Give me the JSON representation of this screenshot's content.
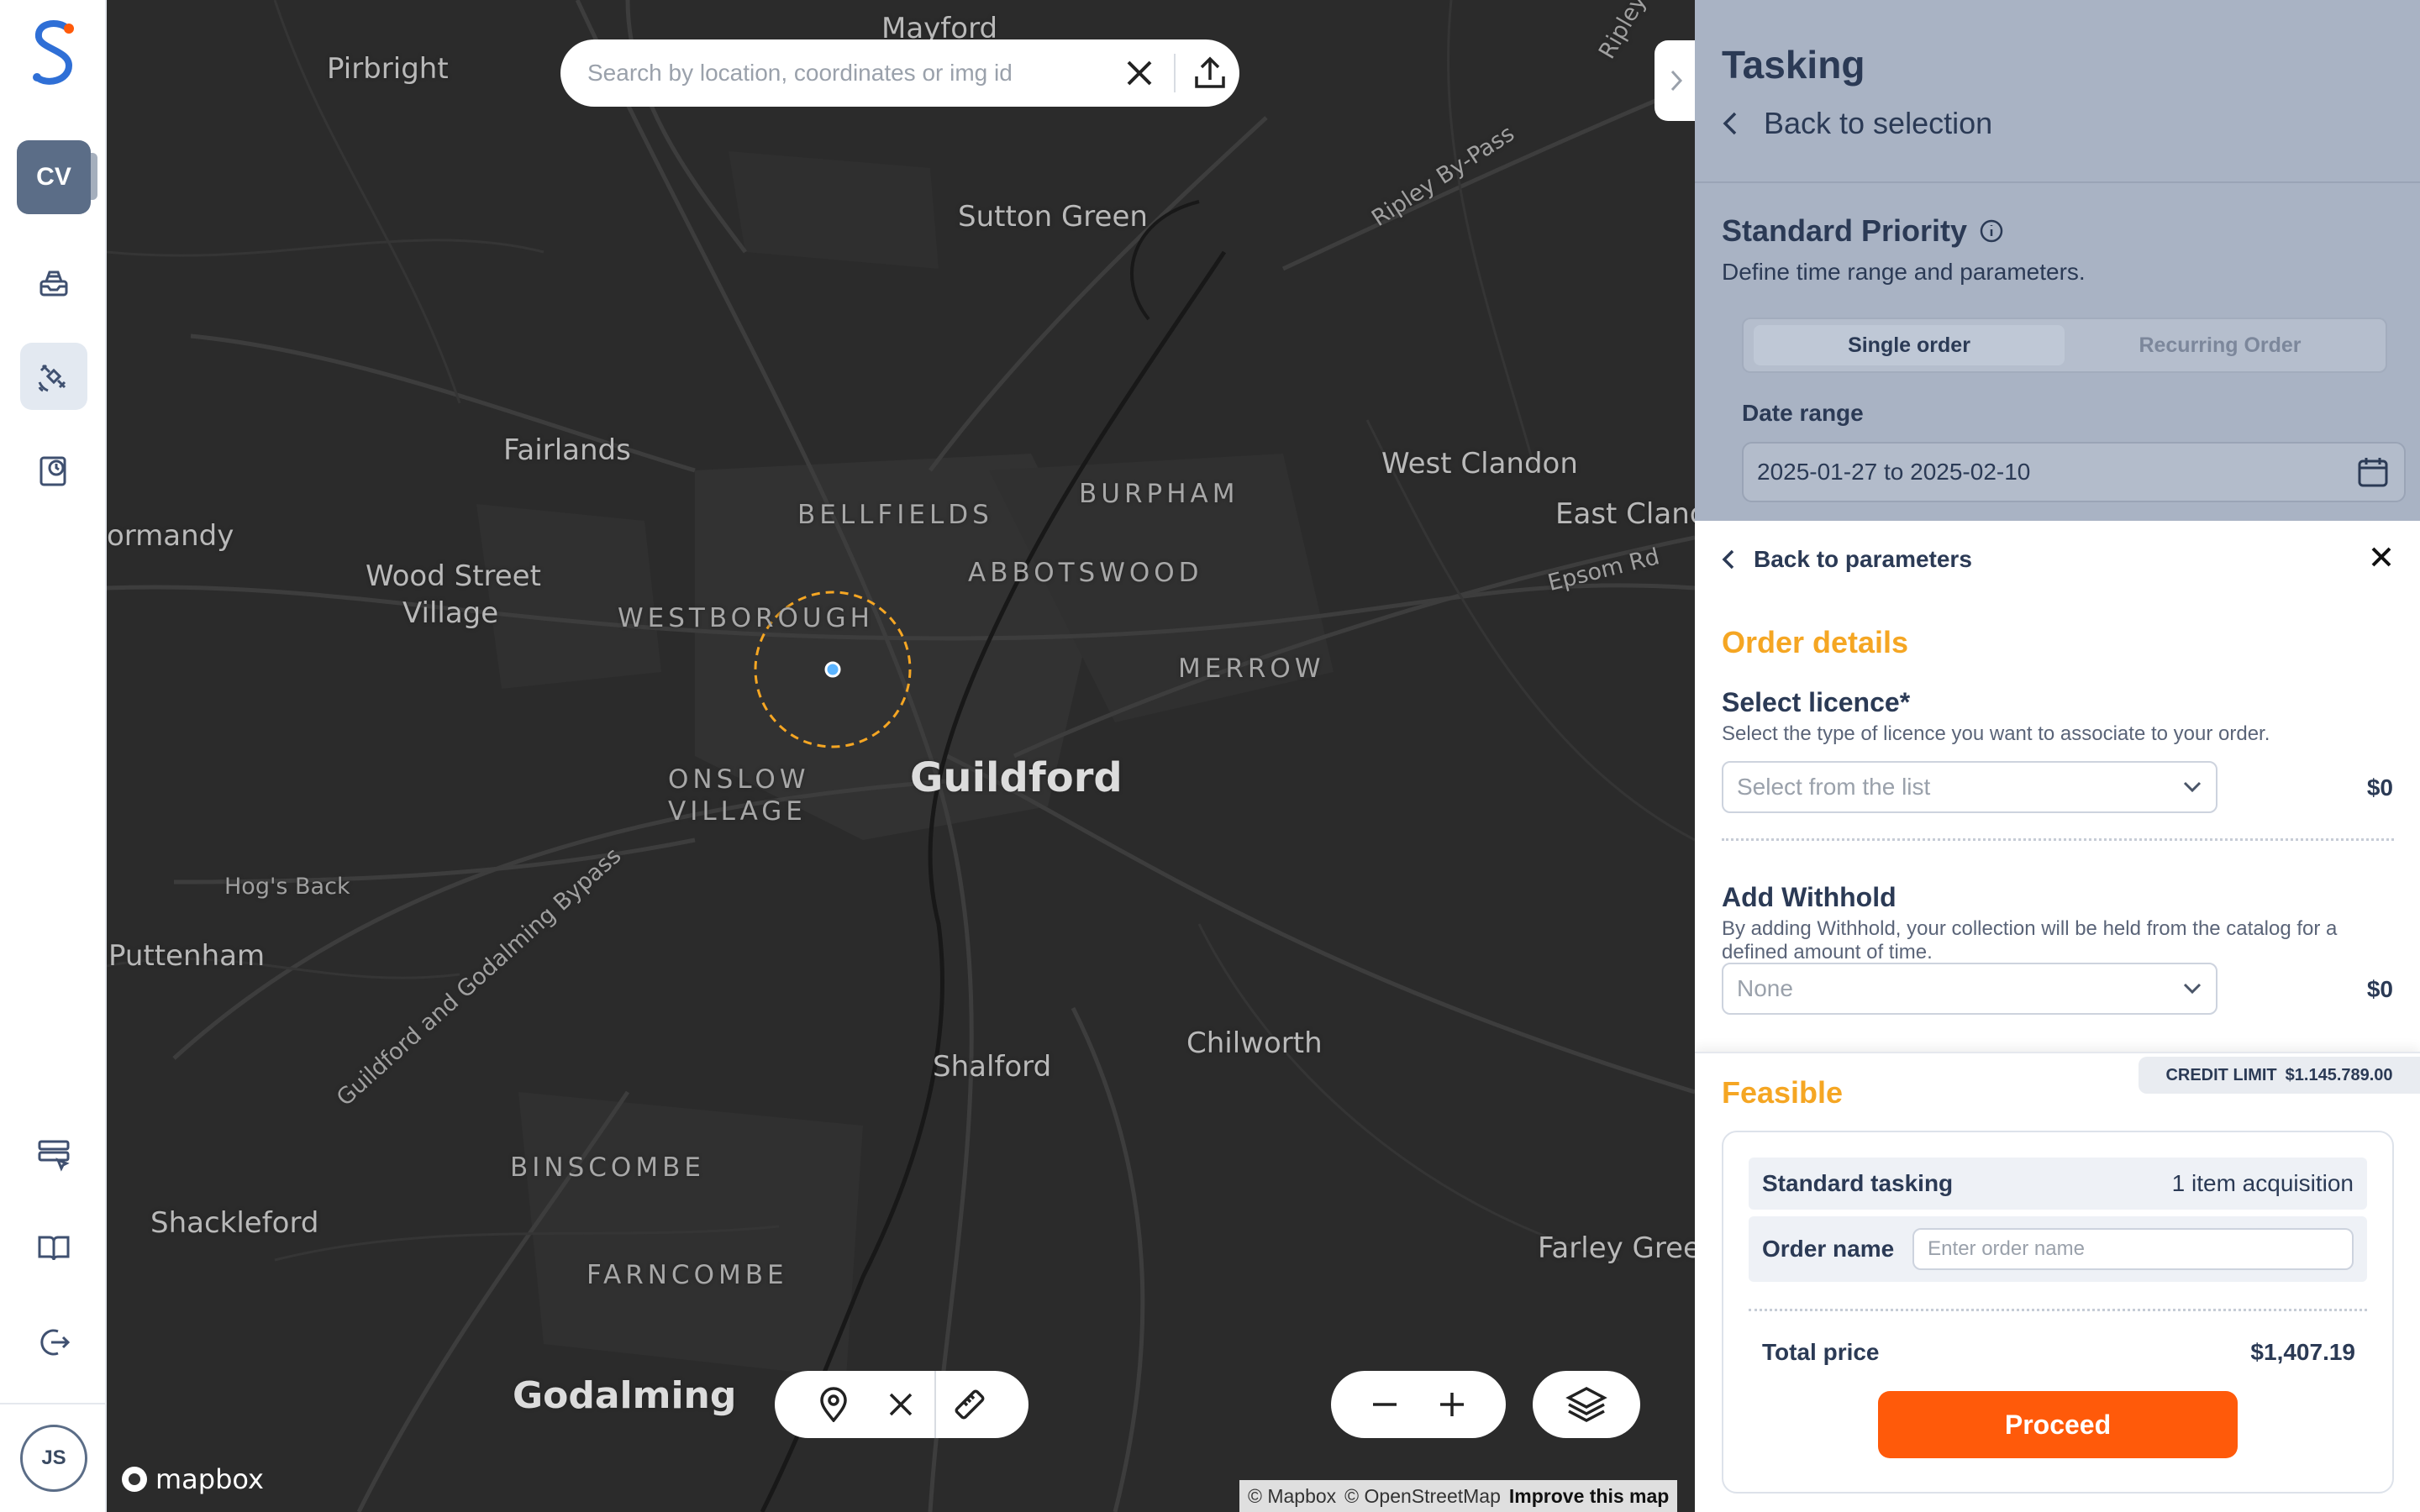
{
  "nav": {
    "workspace_initials": "CV",
    "user_initials": "JS",
    "items": [
      {
        "name": "inbox"
      },
      {
        "name": "satellite"
      },
      {
        "name": "history"
      }
    ],
    "bottom_items": [
      {
        "name": "tasking-list"
      },
      {
        "name": "docs"
      },
      {
        "name": "logout"
      }
    ]
  },
  "map": {
    "search_placeholder": "Search by location, coordinates or img id",
    "labels": {
      "mayford": "Mayford",
      "pirbright": "Pirbright",
      "sutton_green": "Sutton Green",
      "ripley_bypass": "Ripley By-Pass",
      "ripley": "Ripley",
      "fairlands": "Fairlands",
      "bellfields": "BELLFIELDS",
      "burpham": "BURPHAM",
      "west_clandon": "West Clandon",
      "east_clandon": "East Cland",
      "epsom_rd": "Epsom Rd",
      "normandy": "ormandy",
      "wood_street": "Wood Street",
      "village": "Village",
      "westborough": "WESTBOROUGH",
      "abbotswood": "ABBOTSWOOD",
      "merrow": "MERROW",
      "onslow": "ONSLOW",
      "onslow_village": "VILLAGE",
      "guildford": "Guildford",
      "hogs_back": "Hog's Back",
      "bypass": "Guildford and Godalming Bypass",
      "puttenham": "Puttenham",
      "shalford": "Shalford",
      "chilworth": "Chilworth",
      "binscombe": "BINSCOMBE",
      "shackleford": "Shackleford",
      "farncombe": "FARNCOMBE",
      "farley_green": "Farley Gree",
      "godalming": "Godalming"
    },
    "mapbox_logo": "mapbox",
    "attribution_mapbox": "© Mapbox",
    "attribution_osm": "© OpenStreetMap",
    "attribution_improve": "Improve this map"
  },
  "panel": {
    "title": "Tasking",
    "back_to_selection": "Back to selection",
    "priority_title": "Standard Priority",
    "priority_subtitle": "Define time range and parameters.",
    "order_modes": [
      "Single order",
      "Recurring Order"
    ],
    "date_range_label": "Date range",
    "date_range_value": "2025-01-27 to 2025-02-10",
    "back_to_parameters": "Back to parameters",
    "order_details_title": "Order details",
    "licence_title": "Select licence*",
    "licence_desc": "Select the type of licence you want to associate to your order.",
    "licence_placeholder": "Select from the list",
    "licence_price": "$0",
    "withhold_title": "Add Withhold",
    "withhold_desc": "By adding Withhold, your collection will be held from the catalog for a defined amount of time.",
    "withhold_value": "None",
    "withhold_price": "$0",
    "feasible_title": "Feasible",
    "credit_limit_label": "CREDIT LIMIT",
    "credit_limit_value": "$1.145.789.00",
    "tasking_label": "Standard tasking",
    "tasking_value": "1 item acquisition",
    "order_name_label": "Order name",
    "order_name_placeholder": "Enter order name",
    "total_label": "Total price",
    "total_value": "$1,407.19",
    "proceed_label": "Proceed"
  },
  "colors": {
    "accent_orange": "#ff5a0a",
    "heading_yellow": "#f5a623",
    "navy": "#2b3a55",
    "map_bg": "#2b2b2b"
  }
}
